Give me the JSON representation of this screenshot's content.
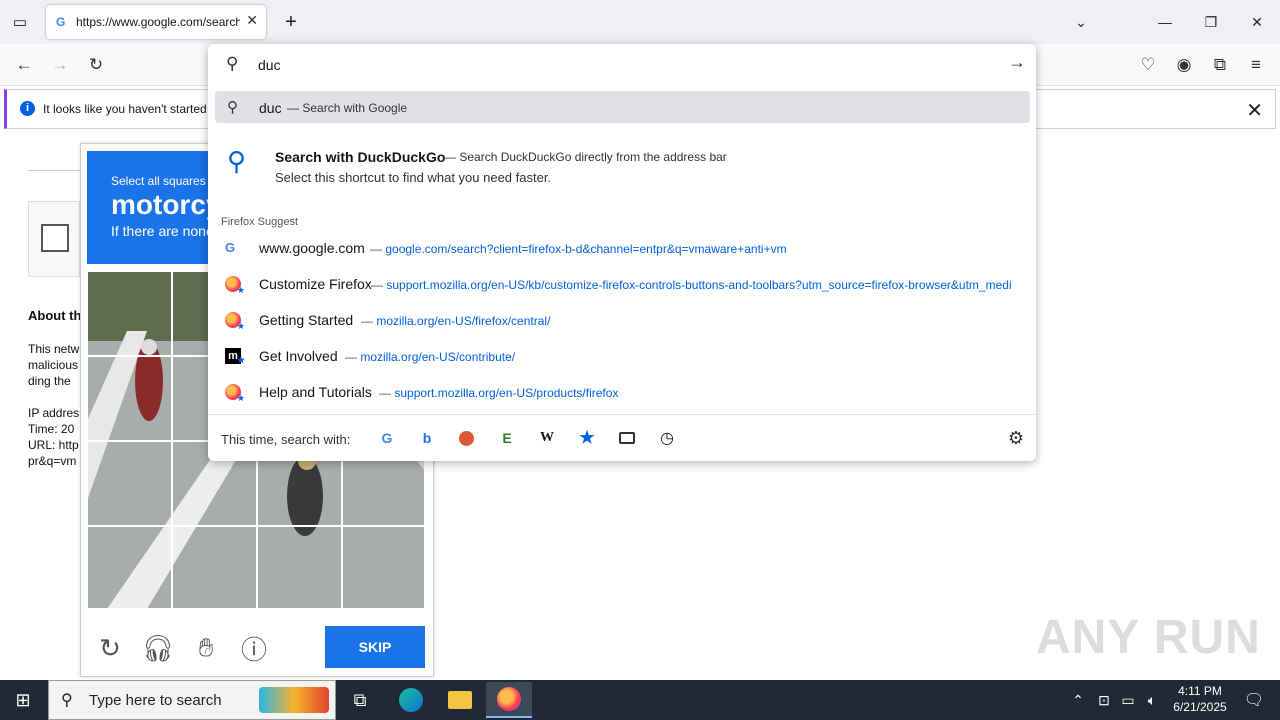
{
  "browser": {
    "tab_title": "https://www.google.com/search?",
    "tab_favicon": "G"
  },
  "notification": {
    "message": "It looks like you haven't started"
  },
  "page": {
    "about_heading": "About th",
    "para_lines": [
      "This netw",
      "malicious",
      "ding the"
    ],
    "info_lines": [
      "IP addres",
      "Time: 20",
      "URL: http",
      "pr&q=vm"
    ]
  },
  "captcha": {
    "instruction": "Select all squares",
    "target": "motorcy",
    "sub": "If there are none",
    "skip_label": "SKIP"
  },
  "urlbar": {
    "query": "duc",
    "highlight_query": "duc",
    "highlight_suffix": "Search with Google",
    "ddg_title": "Search with DuckDuckGo",
    "ddg_desc": "Search DuckDuckGo directly from the address bar",
    "ddg_line2": "Select this shortcut to find what you need faster.",
    "suggest_label": "Firefox Suggest",
    "items": [
      {
        "icon": "google-icon",
        "title": "www.google.com",
        "url": "google.com/search?client=firefox-b-d&channel=entpr&q=vmaware+anti+vm"
      },
      {
        "icon": "firefox-icon",
        "title": "Customize Firefox",
        "url": "support.mozilla.org/en-US/kb/customize-firefox-controls-buttons-and-toolbars?utm_source=firefox-browser&utm_medi"
      },
      {
        "icon": "firefox-icon",
        "title": "Getting Started",
        "url": "mozilla.org/en-US/firefox/central/"
      },
      {
        "icon": "mozilla-icon",
        "title": "Get Involved",
        "url": "mozilla.org/en-US/contribute/"
      },
      {
        "icon": "firefox-icon",
        "title": "Help and Tutorials",
        "url": "support.mozilla.org/en-US/products/firefox"
      }
    ],
    "oneoff_label": "This time, search with:"
  },
  "taskbar": {
    "search_placeholder": "Type here to search",
    "time": "4:11 PM",
    "date": "6/21/2025"
  },
  "watermark": "ANY RUN",
  "colors": {
    "accent": "#0060df",
    "captcha_blue": "#1a73e8",
    "taskbar": "#1f2a36"
  }
}
